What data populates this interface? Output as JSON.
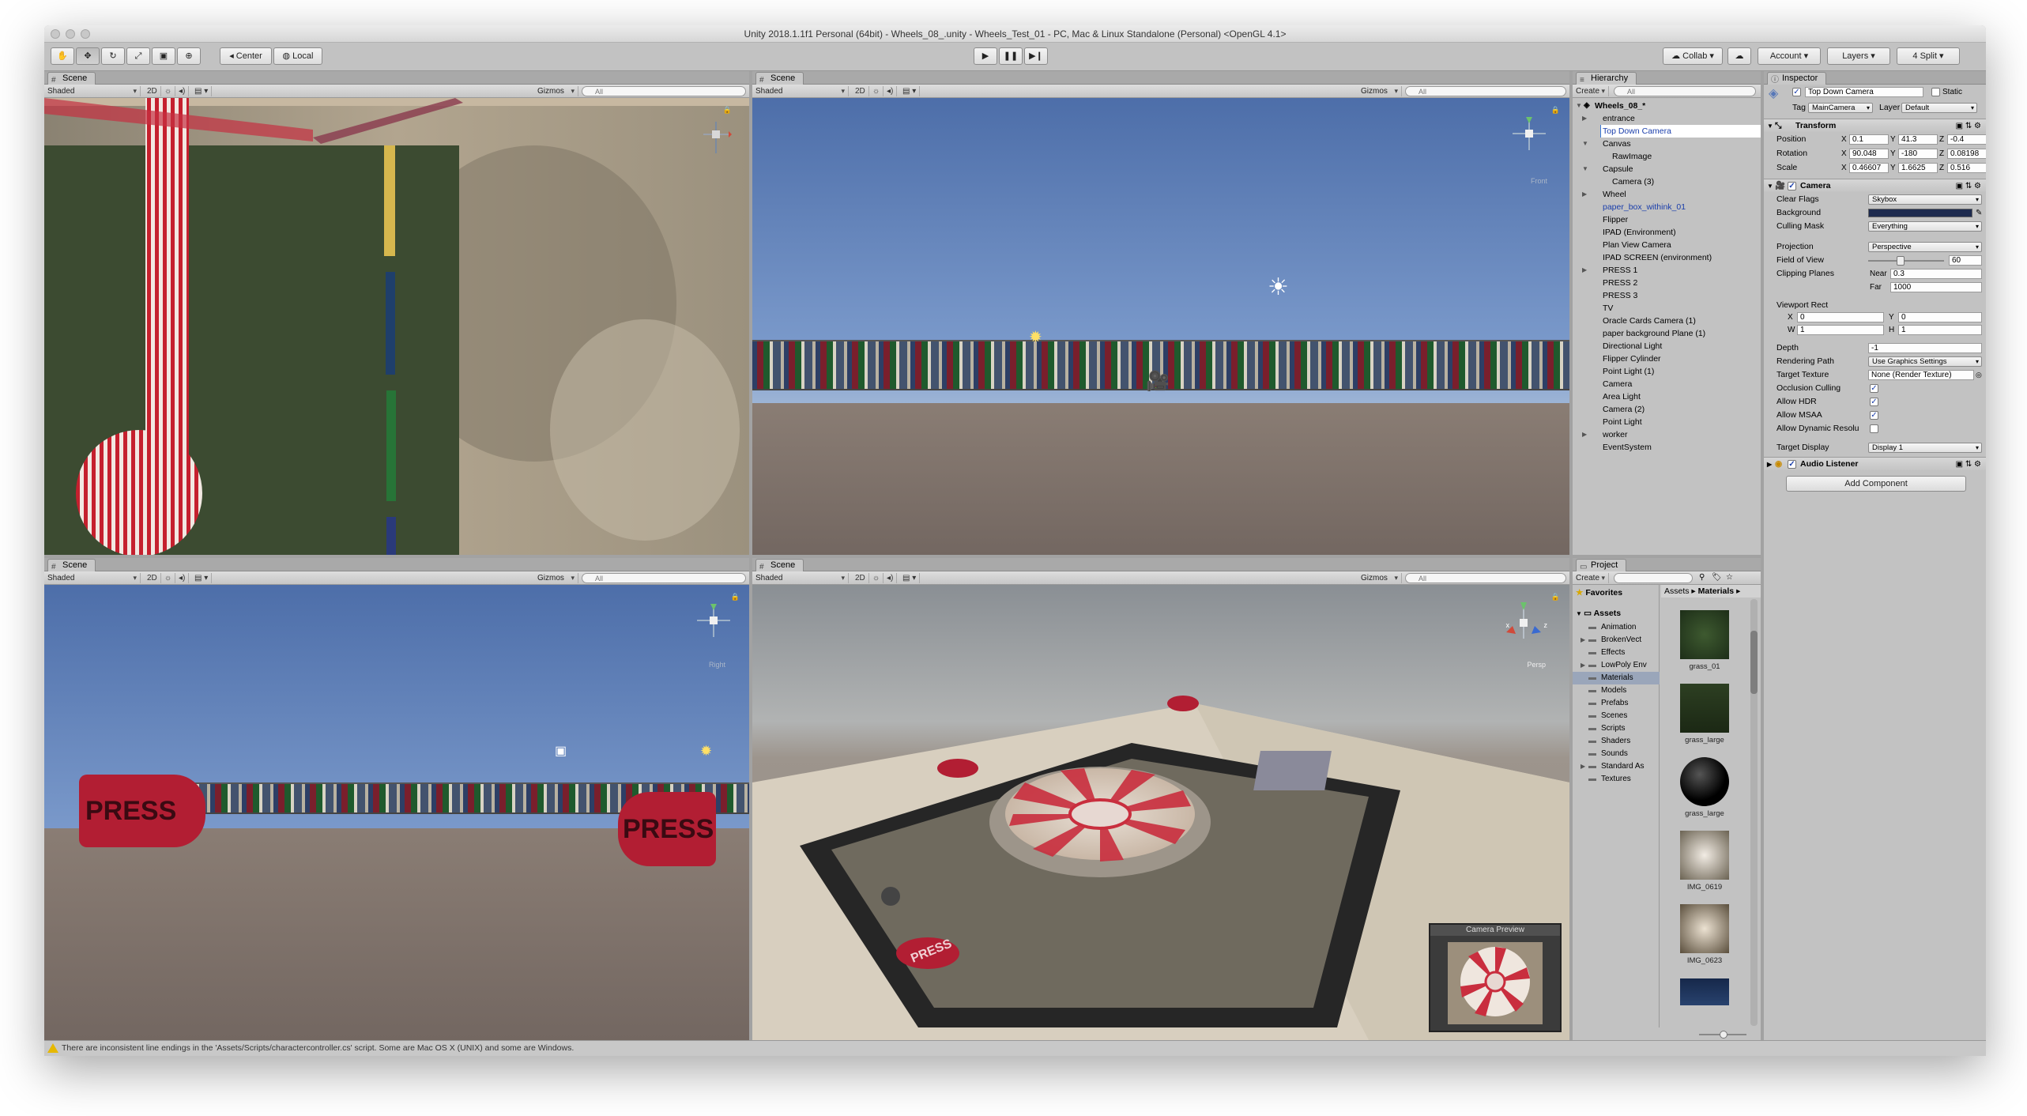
{
  "window": {
    "title": "Unity 2018.1.1f1 Personal (64bit) - Wheels_08_.unity - Wheels_Test_01 - PC, Mac & Linux Standalone (Personal) <OpenGL 4.1>"
  },
  "toolbar": {
    "pivot_label": "Center",
    "space_label": "Local",
    "collab_label": "Collab",
    "account_label": "Account",
    "layers_label": "Layers",
    "layout_label": "4 Split"
  },
  "scene": {
    "tab_label": "Scene",
    "shading": "Shaded",
    "mode_2d": "2D",
    "gizmos": "Gizmos",
    "search_placeholder": "All"
  },
  "views": {
    "top_left": {
      "axis_label": ""
    },
    "top_right": {
      "axis_label": "Front"
    },
    "bottom_left": {
      "axis_label": "Right"
    },
    "bottom_right": {
      "axis_label": "Persp",
      "axis_x": "x",
      "axis_z": "z"
    },
    "press_left": "PRESS",
    "press_right": "PRESS",
    "press_tabletop": "PRESS"
  },
  "camera_preview": {
    "title": "Camera Preview"
  },
  "hierarchy": {
    "tab_label": "Hierarchy",
    "create_label": "Create",
    "search_placeholder": "All",
    "scene_name": "Wheels_08_*",
    "items": [
      {
        "label": "entrance",
        "indent": 1,
        "fold": true,
        "blue": false,
        "selected": false
      },
      {
        "label": "Top Down Camera",
        "indent": 1,
        "fold": false,
        "blue": false,
        "selected": true
      },
      {
        "label": "Canvas",
        "indent": 1,
        "fold": true,
        "open": true,
        "blue": false,
        "selected": false
      },
      {
        "label": "RawImage",
        "indent": 2,
        "fold": false,
        "blue": false,
        "selected": false
      },
      {
        "label": "Capsule",
        "indent": 1,
        "fold": true,
        "open": true,
        "blue": false,
        "selected": false
      },
      {
        "label": "Camera (3)",
        "indent": 2,
        "fold": false,
        "blue": false,
        "selected": false
      },
      {
        "label": "Wheel",
        "indent": 1,
        "fold": true,
        "blue": false,
        "selected": false
      },
      {
        "label": "paper_box_withink_01",
        "indent": 1,
        "fold": false,
        "blue": true,
        "selected": false
      },
      {
        "label": "Flipper",
        "indent": 1,
        "fold": false,
        "blue": false,
        "selected": false
      },
      {
        "label": "IPAD (Environment)",
        "indent": 1,
        "fold": false,
        "blue": false,
        "selected": false
      },
      {
        "label": "Plan View Camera",
        "indent": 1,
        "fold": false,
        "blue": false,
        "selected": false
      },
      {
        "label": "IPAD SCREEN (environment)",
        "indent": 1,
        "fold": false,
        "blue": false,
        "selected": false
      },
      {
        "label": "PRESS 1",
        "indent": 1,
        "fold": true,
        "blue": false,
        "selected": false
      },
      {
        "label": "PRESS 2",
        "indent": 1,
        "fold": false,
        "blue": false,
        "selected": false
      },
      {
        "label": "PRESS 3",
        "indent": 1,
        "fold": false,
        "blue": false,
        "selected": false
      },
      {
        "label": "TV",
        "indent": 1,
        "fold": false,
        "blue": false,
        "selected": false
      },
      {
        "label": "Oracle Cards Camera (1)",
        "indent": 1,
        "fold": false,
        "blue": false,
        "selected": false
      },
      {
        "label": "paper background Plane (1)",
        "indent": 1,
        "fold": false,
        "blue": false,
        "selected": false
      },
      {
        "label": "Directional Light",
        "indent": 1,
        "fold": false,
        "blue": false,
        "selected": false
      },
      {
        "label": "Flipper Cylinder",
        "indent": 1,
        "fold": false,
        "blue": false,
        "selected": false
      },
      {
        "label": "Point Light (1)",
        "indent": 1,
        "fold": false,
        "blue": false,
        "selected": false
      },
      {
        "label": "Camera",
        "indent": 1,
        "fold": false,
        "blue": false,
        "selected": false
      },
      {
        "label": "Area Light",
        "indent": 1,
        "fold": false,
        "blue": false,
        "selected": false
      },
      {
        "label": "Camera (2)",
        "indent": 1,
        "fold": false,
        "blue": false,
        "selected": false
      },
      {
        "label": "Point Light",
        "indent": 1,
        "fold": false,
        "blue": false,
        "selected": false
      },
      {
        "label": "worker",
        "indent": 1,
        "fold": true,
        "blue": false,
        "selected": false
      },
      {
        "label": "EventSystem",
        "indent": 1,
        "fold": false,
        "blue": false,
        "selected": false
      }
    ]
  },
  "project": {
    "tab_label": "Project",
    "create_label": "Create",
    "favorites_label": "Favorites",
    "assets_label": "Assets",
    "breadcrumb": [
      "Assets",
      "Materials"
    ],
    "folders": [
      "Animation",
      "BrokenVect",
      "Effects",
      "LowPoly Env",
      "Materials",
      "Models",
      "Prefabs",
      "Scenes",
      "Scripts",
      "Shaders",
      "Sounds",
      "Standard As",
      "Textures"
    ],
    "assets": [
      "grass_01",
      "grass_large",
      "grass_large",
      "IMG_0619",
      "IMG_0623"
    ]
  },
  "inspector": {
    "tab_label": "Inspector",
    "object_name": "Top Down Camera",
    "static_label": "Static",
    "tag_label": "Tag",
    "tag_value": "MainCamera",
    "layer_label": "Layer",
    "layer_value": "Default",
    "transform": {
      "title": "Transform",
      "position_label": "Position",
      "position": [
        "0.1",
        "41.3",
        "-0.4"
      ],
      "rotation_label": "Rotation",
      "rotation": [
        "90.048",
        "-180",
        "0.08198"
      ],
      "scale_label": "Scale",
      "scale": [
        "0.46607",
        "1.6625",
        "0.516"
      ]
    },
    "camera": {
      "title": "Camera",
      "clear_flags_label": "Clear Flags",
      "clear_flags": "Skybox",
      "background_label": "Background",
      "background_color": "#1d2a4e",
      "culling_mask_label": "Culling Mask",
      "culling_mask": "Everything",
      "projection_label": "Projection",
      "projection": "Perspective",
      "fov_label": "Field of View",
      "fov": "60",
      "clipping_label": "Clipping Planes",
      "near_label": "Near",
      "near": "0.3",
      "far_label": "Far",
      "far": "1000",
      "viewport_label": "Viewport Rect",
      "vx": "0",
      "vy": "0",
      "vw": "1",
      "vh": "1",
      "depth_label": "Depth",
      "depth": "-1",
      "rendering_path_label": "Rendering Path",
      "rendering_path": "Use Graphics Settings",
      "target_texture_label": "Target Texture",
      "target_texture": "None (Render Texture)",
      "occlusion_label": "Occlusion Culling",
      "hdr_label": "Allow HDR",
      "msaa_label": "Allow MSAA",
      "dynamic_label": "Allow Dynamic Resolu",
      "target_display_label": "Target Display",
      "target_display": "Display 1"
    },
    "audio_listener": "Audio Listener",
    "add_component": "Add Component"
  },
  "status": {
    "message": "There are inconsistent line endings in the 'Assets/Scripts/charactercontroller.cs' script. Some are Mac OS X (UNIX) and some are Windows."
  }
}
